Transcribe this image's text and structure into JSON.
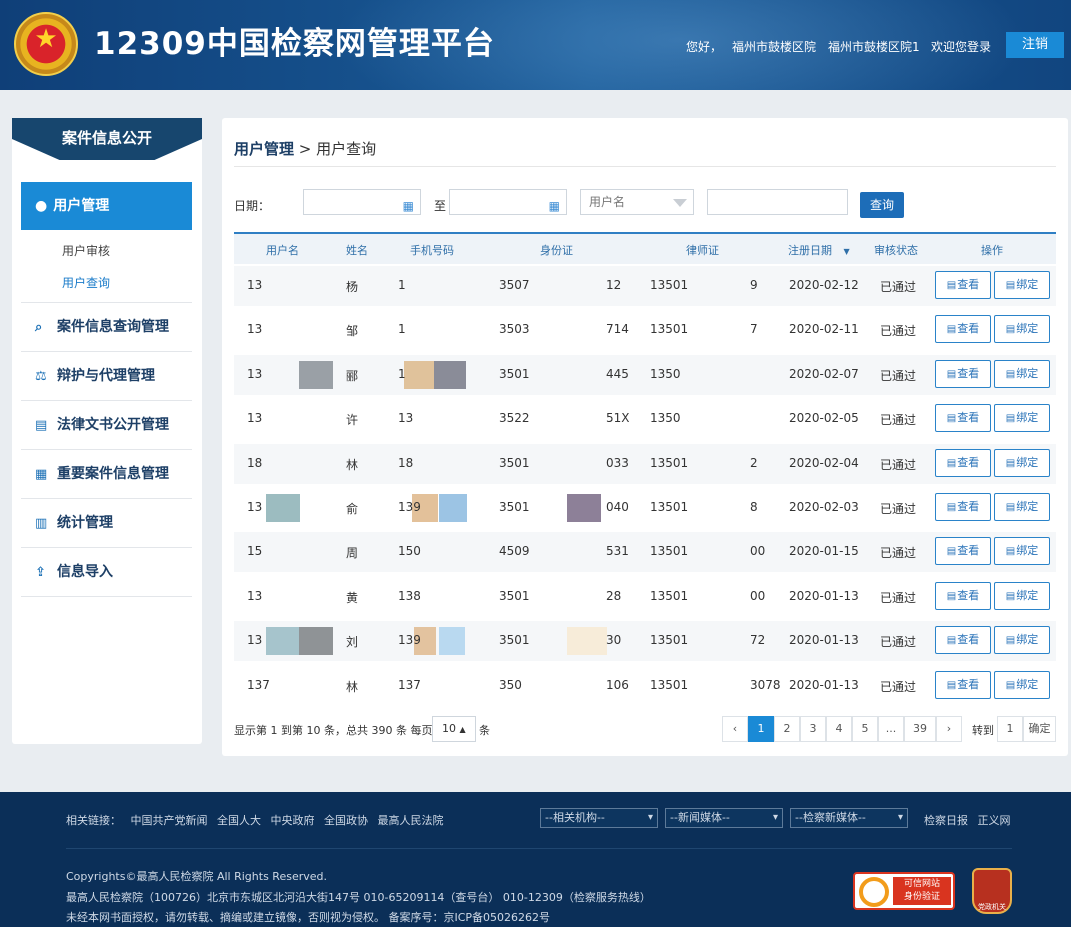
{
  "header": {
    "title": "12309中国检察网管理平台",
    "greeting": "您好，",
    "org1": "福州市鼓楼区院",
    "org2": "福州市鼓楼区院1",
    "welcome": "欢迎您登录",
    "logout": "注销"
  },
  "sidebar": {
    "title": "案件信息公开",
    "active": "用户管理",
    "subs": [
      "用户审核",
      "用户查询"
    ],
    "items": [
      {
        "label": "案件信息查询管理",
        "icon": "search-doc-icon",
        "glyph": "⌕"
      },
      {
        "label": "辩护与代理管理",
        "icon": "lawyer-icon",
        "glyph": "⚖"
      },
      {
        "label": "法律文书公开管理",
        "icon": "book-icon",
        "glyph": "▤"
      },
      {
        "label": "重要案件信息管理",
        "icon": "case-icon",
        "glyph": "▦"
      },
      {
        "label": "统计管理",
        "icon": "chart-icon",
        "glyph": "▥"
      },
      {
        "label": "信息导入",
        "icon": "import-icon",
        "glyph": "⇪"
      }
    ]
  },
  "breadcrumb": {
    "parent": "用户管理",
    "sep": ">",
    "current": "用户查询"
  },
  "filters": {
    "date_label": "日期：",
    "to_label": "至",
    "username_select": "用户名",
    "search_button": "查询"
  },
  "table": {
    "columns": [
      "用户名",
      "姓名",
      "手机号码",
      "身份证",
      "律师证",
      "注册日期",
      "审核状态",
      "操作"
    ],
    "view_label": "查看",
    "bind_label": "绑定",
    "rows": [
      [
        "13",
        "杨",
        "1",
        "3507",
        "12",
        "13501",
        "9",
        "2020-02-12",
        "已通过"
      ],
      [
        "13",
        "邹",
        "1",
        "3503",
        "714",
        "13501",
        "7",
        "2020-02-11",
        "已通过"
      ],
      [
        "13",
        "郦",
        "1",
        "3501",
        "445",
        "1350",
        "",
        "2020-02-07",
        "已通过"
      ],
      [
        "13",
        "许",
        "13",
        "3522",
        "51X",
        "1350",
        "",
        "2020-02-05",
        "已通过"
      ],
      [
        "18",
        "林",
        "18",
        "3501",
        "033",
        "13501",
        "2",
        "2020-02-04",
        "已通过"
      ],
      [
        "13",
        "俞",
        "139",
        "3501",
        "040",
        "13501",
        "8",
        "2020-02-03",
        "已通过"
      ],
      [
        "15",
        "周",
        "150",
        "4509",
        "531",
        "13501",
        "00",
        "2020-01-15",
        "已通过"
      ],
      [
        "13",
        "黄",
        "138",
        "3501",
        "28",
        "13501",
        "00",
        "2020-01-13",
        "已通过"
      ],
      [
        "13",
        "刘",
        "139",
        "3501",
        "30",
        "13501",
        "72",
        "2020-01-13",
        "已通过"
      ],
      [
        "137",
        "林",
        "137",
        "350",
        "106",
        "13501",
        "3078",
        "2020-01-13",
        "已通过"
      ]
    ]
  },
  "pagination": {
    "info_prefix": "显示第 1 到第 10 条，总共 390 条 每页",
    "per_page": "10",
    "info_suffix": "条",
    "prev": "‹",
    "pages": [
      "1",
      "2",
      "3",
      "4",
      "5",
      "...",
      "39"
    ],
    "next": "›",
    "goto_label": "转到",
    "goto_value": "1",
    "confirm": "确定"
  },
  "footer": {
    "links_label": "相关链接：",
    "links": [
      "中国共产党新闻",
      "全国人大",
      "中央政府",
      "全国政协",
      "最高人民法院"
    ],
    "selects": [
      "--相关机构--",
      "--新闻媒体--",
      "--检察新媒体--"
    ],
    "right_links": [
      "检察日报",
      "正义网"
    ],
    "copyright": "Copyrights©最高人民检察院 All Rights Reserved.",
    "address": "最高人民检察院（100726）北京市东城区北河沿大街147号 010-65209114（查号台） 010-12309（检察服务热线）",
    "notice": "未经本网书面授权，请勿转载、摘编或建立镜像，否则视为侵权。 备案序号：京ICP备05026262号",
    "badge1_line1": "可信网站",
    "badge1_line2": "身份验证",
    "badge2": "党政机关"
  },
  "colors": {
    "header": "#11457f",
    "accent": "#1a8ad6",
    "sidebar_title": "#17466e",
    "footer": "#0b2f58"
  }
}
